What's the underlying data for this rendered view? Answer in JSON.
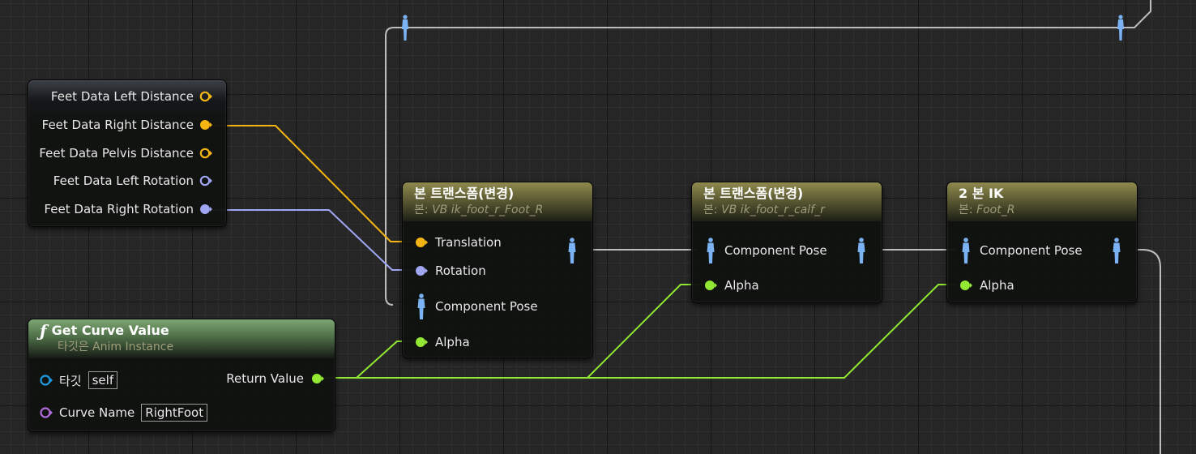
{
  "colors": {
    "float_pin": "#f5b614",
    "rotator_pin": "#a0a6f2",
    "alpha_pin": "#92e833",
    "pose_pin": "#7bb2f4",
    "object_pin": "#1f9ae0",
    "name_pin": "#b06cd8",
    "pose_wire": "#bdbdbd"
  },
  "break_node": {
    "pins": [
      {
        "label": "Feet Data Left Distance",
        "type": "float",
        "connected": false
      },
      {
        "label": "Feet Data Right Distance",
        "type": "float",
        "connected": true
      },
      {
        "label": "Feet Data Pelvis Distance",
        "type": "float",
        "connected": false
      },
      {
        "label": "Feet Data Left Rotation",
        "type": "rotator",
        "connected": false
      },
      {
        "label": "Feet Data Right Rotation",
        "type": "rotator",
        "connected": true
      }
    ]
  },
  "get_curve": {
    "icon": "function-icon",
    "title": "Get Curve Value",
    "subtitle": "타깃은 Anim Instance",
    "target_label": "타깃",
    "target_value": "self",
    "curve_label": "Curve Name",
    "curve_value": "RightFoot",
    "return_label": "Return Value"
  },
  "bt1": {
    "title": "본 트랜스폼(변경)",
    "sub_prefix": "본:",
    "sub_value": "VB ik_foot_r_Foot_R",
    "pins": [
      "Translation",
      "Rotation",
      "Component Pose",
      "Alpha"
    ]
  },
  "bt2": {
    "title": "본 트랜스폼(변경)",
    "sub_prefix": "본:",
    "sub_value": "VB ik_foot_r_calf_r",
    "pins": [
      "Component Pose",
      "Alpha"
    ]
  },
  "ik": {
    "title": "2 본 IK",
    "sub_prefix": "본:",
    "sub_value": "Foot_R",
    "pins": [
      "Component Pose",
      "Alpha"
    ]
  }
}
